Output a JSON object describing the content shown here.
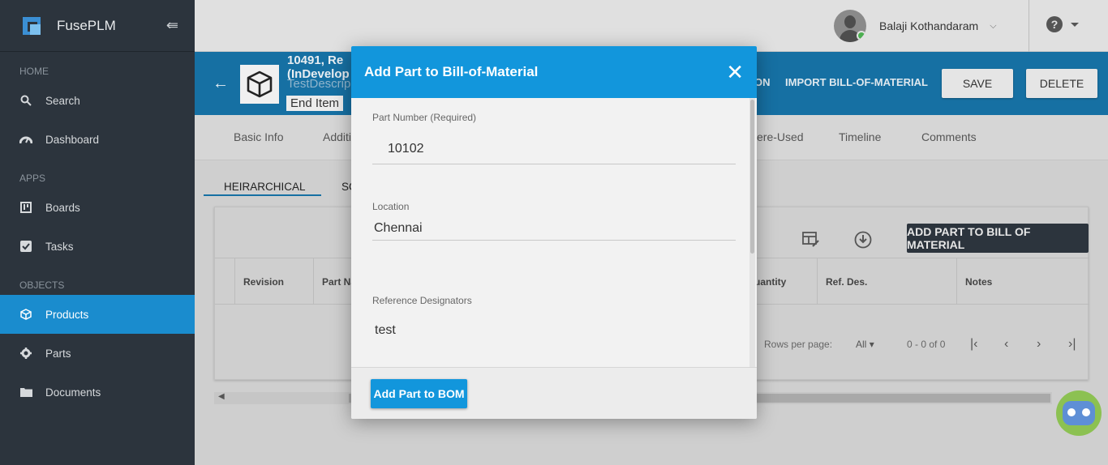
{
  "sidebar": {
    "brand": "FusePLM",
    "sections": {
      "home": "HOME",
      "apps": "APPS",
      "objects": "OBJECTS"
    },
    "items": {
      "search": "Search",
      "dashboard": "Dashboard",
      "boards": "Boards",
      "tasks": "Tasks",
      "products": "Products",
      "parts": "Parts",
      "documents": "Documents"
    }
  },
  "topbar": {
    "user_name": "Balaji Kothandaram"
  },
  "product": {
    "title_line1": "10491,   Re",
    "title_line2": "(InDevelop",
    "description": "TestDescrip",
    "tag": "End Item",
    "links": {
      "partial": "ON",
      "import_bom": "IMPORT BILL-OF-MATERIAL"
    },
    "buttons": {
      "save": "SAVE",
      "delete": "DELETE"
    }
  },
  "tabs": {
    "basic_info": "Basic Info",
    "additional": "Additi",
    "where_used": "ere-Used",
    "timeline": "Timeline",
    "comments": "Comments"
  },
  "subtabs": {
    "hierarchical": "HEIRARCHICAL",
    "second": "SC"
  },
  "table": {
    "add_button": "ADD PART TO BILL OF MATERIAL",
    "columns": {
      "revision": "Revision",
      "part_name": "Part Na",
      "quantity": "uantity",
      "ref_des": "Ref. Des.",
      "notes": "Notes"
    },
    "rows_per_page_label": "Rows per page:",
    "rows_per_page_value": "All",
    "range": "0 - 0 of 0"
  },
  "modal": {
    "title": "Add Part to Bill-of-Material",
    "fields": {
      "part_number": {
        "label": "Part Number (Required)",
        "value": "10102"
      },
      "location": {
        "label": "Location",
        "value": "Chennai"
      },
      "ref_designators": {
        "label": "Reference Designators",
        "value": "test"
      }
    },
    "submit": "Add Part to BOM"
  }
}
